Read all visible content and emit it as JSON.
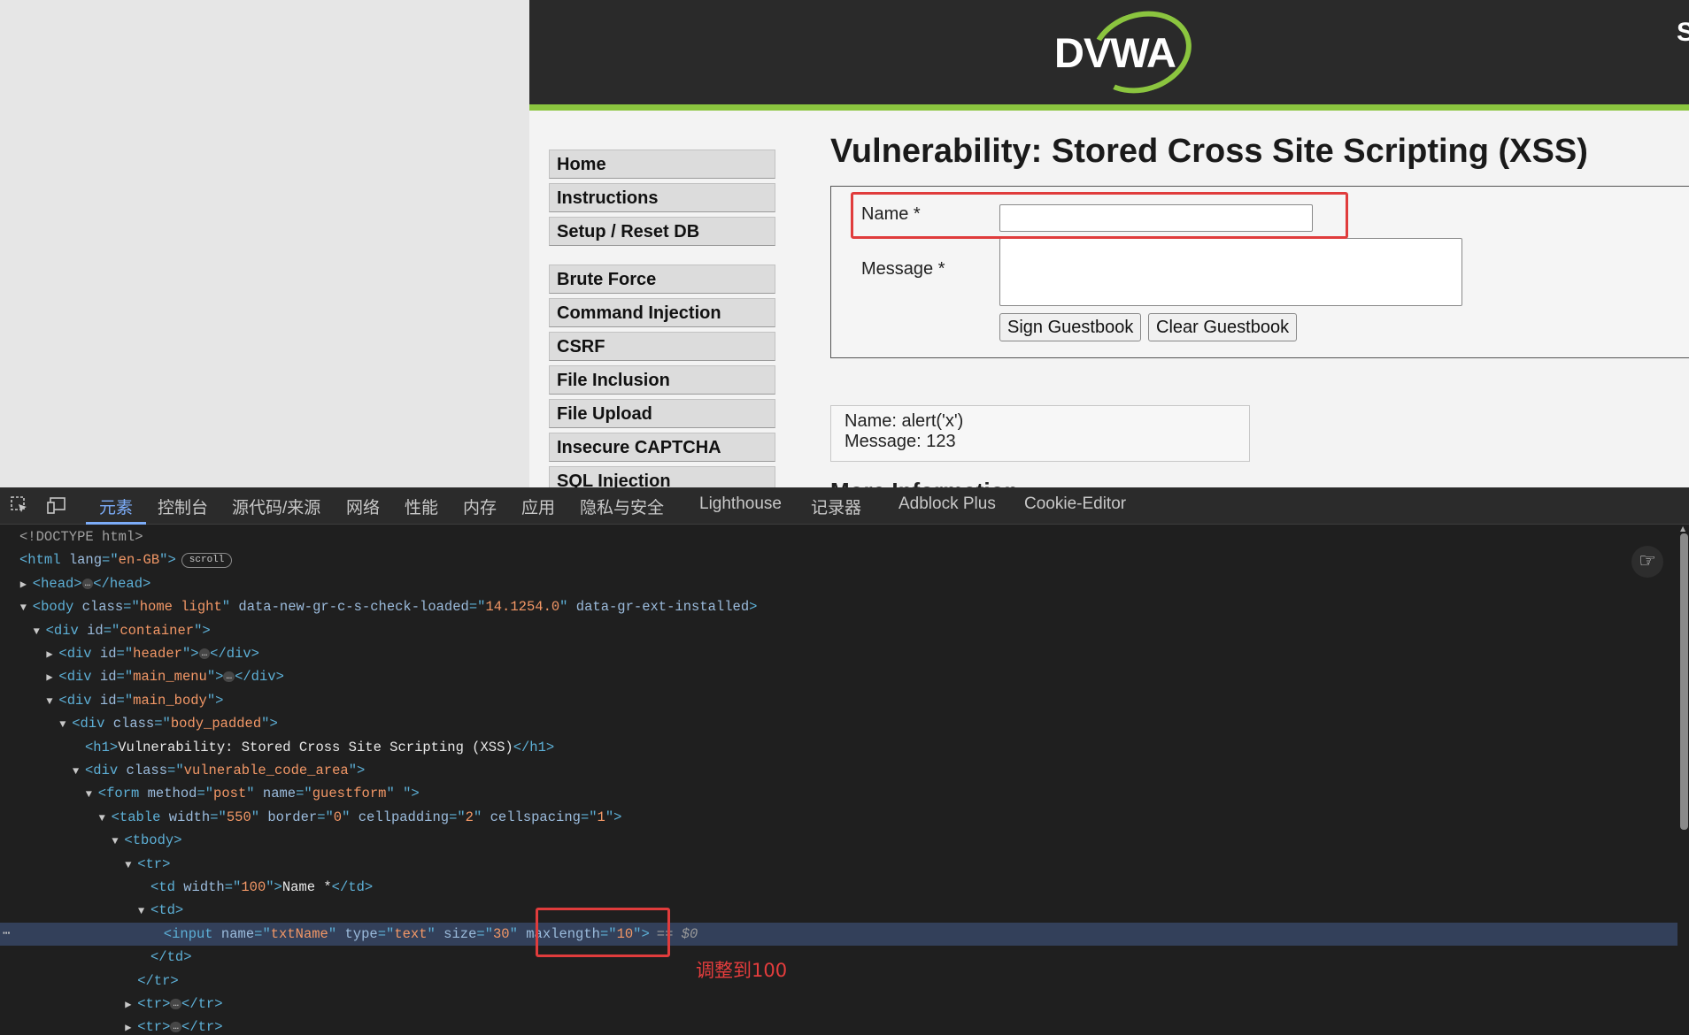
{
  "page": {
    "logo_text": "DVWA",
    "corner_glyph": "S",
    "menu": {
      "group1": [
        "Home",
        "Instructions",
        "Setup / Reset DB"
      ],
      "group2": [
        "Brute Force",
        "Command Injection",
        "CSRF",
        "File Inclusion",
        "File Upload",
        "Insecure CAPTCHA",
        "SQL Injection"
      ]
    },
    "title": "Vulnerability: Stored Cross Site Scripting (XSS)",
    "form": {
      "name_label": "Name *",
      "message_label": "Message *",
      "name_value": "",
      "message_value": "",
      "sign_button": "Sign Guestbook",
      "clear_button": "Clear Guestbook"
    },
    "entry": {
      "name_line": "Name: alert('x')",
      "message_line": "Message: 123"
    },
    "clipped_heading": "More Information"
  },
  "devtools": {
    "tabs": [
      "元素",
      "控制台",
      "源代码/来源",
      "网络",
      "性能",
      "内存",
      "应用",
      "隐私与安全",
      "Lighthouse",
      "记录器",
      "Adblock Plus",
      "Cookie-Editor"
    ],
    "icons": [
      "inspect-icon",
      "device-toolbar-icon"
    ],
    "scroll_badge": "scroll",
    "ellipsis": "…",
    "selected_suffix": "== $0",
    "row_menu": "⋯",
    "annotation": "调整到100",
    "accent_color": "#7cacf8",
    "highlight_color": "#e03c3c",
    "dom_lines": [
      {
        "indent": 0,
        "arrow": "",
        "segs": [
          {
            "c": "dt",
            "t": "<!DOCTYPE html>"
          }
        ]
      },
      {
        "indent": 0,
        "arrow": "",
        "segs": [
          {
            "c": "tag",
            "t": "<html"
          },
          {
            "c": "tx",
            "t": " "
          },
          {
            "c": "an",
            "t": "lang"
          },
          {
            "c": "tag",
            "t": "=\""
          },
          {
            "c": "av",
            "t": "en-GB"
          },
          {
            "c": "tag",
            "t": "\">"
          }
        ],
        "badge": true
      },
      {
        "indent": 1,
        "arrow": "▶",
        "segs": [
          {
            "c": "tag",
            "t": "<head>"
          }
        ],
        "dots": true,
        "close": "</head>"
      },
      {
        "indent": 1,
        "arrow": "▼",
        "segs": [
          {
            "c": "tag",
            "t": "<body"
          },
          {
            "c": "tx",
            "t": " "
          },
          {
            "c": "an",
            "t": "class"
          },
          {
            "c": "tag",
            "t": "=\""
          },
          {
            "c": "av",
            "t": "home light"
          },
          {
            "c": "tag",
            "t": "\""
          },
          {
            "c": "tx",
            "t": " "
          },
          {
            "c": "an",
            "t": "data-new-gr-c-s-check-loaded"
          },
          {
            "c": "tag",
            "t": "=\""
          },
          {
            "c": "av",
            "t": "14.1254.0"
          },
          {
            "c": "tag",
            "t": "\""
          },
          {
            "c": "tx",
            "t": " "
          },
          {
            "c": "an",
            "t": "data-gr-ext-installed"
          },
          {
            "c": "tag",
            "t": ">"
          }
        ]
      },
      {
        "indent": 2,
        "arrow": "▼",
        "segs": [
          {
            "c": "tag",
            "t": "<div"
          },
          {
            "c": "tx",
            "t": " "
          },
          {
            "c": "an",
            "t": "id"
          },
          {
            "c": "tag",
            "t": "=\""
          },
          {
            "c": "av",
            "t": "container"
          },
          {
            "c": "tag",
            "t": "\">"
          }
        ]
      },
      {
        "indent": 3,
        "arrow": "▶",
        "segs": [
          {
            "c": "tag",
            "t": "<div"
          },
          {
            "c": "tx",
            "t": " "
          },
          {
            "c": "an",
            "t": "id"
          },
          {
            "c": "tag",
            "t": "=\""
          },
          {
            "c": "av",
            "t": "header"
          },
          {
            "c": "tag",
            "t": "\">"
          }
        ],
        "dots": true,
        "close": "</div>"
      },
      {
        "indent": 3,
        "arrow": "▶",
        "segs": [
          {
            "c": "tag",
            "t": "<div"
          },
          {
            "c": "tx",
            "t": " "
          },
          {
            "c": "an",
            "t": "id"
          },
          {
            "c": "tag",
            "t": "=\""
          },
          {
            "c": "av",
            "t": "main_menu"
          },
          {
            "c": "tag",
            "t": "\">"
          }
        ],
        "dots": true,
        "close": "</div>"
      },
      {
        "indent": 3,
        "arrow": "▼",
        "segs": [
          {
            "c": "tag",
            "t": "<div"
          },
          {
            "c": "tx",
            "t": " "
          },
          {
            "c": "an",
            "t": "id"
          },
          {
            "c": "tag",
            "t": "=\""
          },
          {
            "c": "av",
            "t": "main_body"
          },
          {
            "c": "tag",
            "t": "\">"
          }
        ]
      },
      {
        "indent": 4,
        "arrow": "▼",
        "segs": [
          {
            "c": "tag",
            "t": "<div"
          },
          {
            "c": "tx",
            "t": " "
          },
          {
            "c": "an",
            "t": "class"
          },
          {
            "c": "tag",
            "t": "=\""
          },
          {
            "c": "av",
            "t": "body_padded"
          },
          {
            "c": "tag",
            "t": "\">"
          }
        ]
      },
      {
        "indent": 5,
        "arrow": "",
        "segs": [
          {
            "c": "tag",
            "t": "<h1>"
          },
          {
            "c": "tx",
            "t": "Vulnerability: Stored Cross Site Scripting (XSS)"
          },
          {
            "c": "tag",
            "t": "</h1>"
          }
        ]
      },
      {
        "indent": 5,
        "arrow": "▼",
        "segs": [
          {
            "c": "tag",
            "t": "<div"
          },
          {
            "c": "tx",
            "t": " "
          },
          {
            "c": "an",
            "t": "class"
          },
          {
            "c": "tag",
            "t": "=\""
          },
          {
            "c": "av",
            "t": "vulnerable_code_area"
          },
          {
            "c": "tag",
            "t": "\">"
          }
        ]
      },
      {
        "indent": 6,
        "arrow": "▼",
        "segs": [
          {
            "c": "tag",
            "t": "<form"
          },
          {
            "c": "tx",
            "t": " "
          },
          {
            "c": "an",
            "t": "method"
          },
          {
            "c": "tag",
            "t": "=\""
          },
          {
            "c": "av",
            "t": "post"
          },
          {
            "c": "tag",
            "t": "\""
          },
          {
            "c": "tx",
            "t": " "
          },
          {
            "c": "an",
            "t": "name"
          },
          {
            "c": "tag",
            "t": "=\""
          },
          {
            "c": "av",
            "t": "guestform"
          },
          {
            "c": "tag",
            "t": "\""
          },
          {
            "c": "tx",
            "t": " "
          },
          {
            "c": "tag",
            "t": "\">"
          }
        ]
      },
      {
        "indent": 7,
        "arrow": "▼",
        "segs": [
          {
            "c": "tag",
            "t": "<table"
          },
          {
            "c": "tx",
            "t": " "
          },
          {
            "c": "an",
            "t": "width"
          },
          {
            "c": "tag",
            "t": "=\""
          },
          {
            "c": "av",
            "t": "550"
          },
          {
            "c": "tag",
            "t": "\""
          },
          {
            "c": "tx",
            "t": " "
          },
          {
            "c": "an",
            "t": "border"
          },
          {
            "c": "tag",
            "t": "=\""
          },
          {
            "c": "av",
            "t": "0"
          },
          {
            "c": "tag",
            "t": "\""
          },
          {
            "c": "tx",
            "t": " "
          },
          {
            "c": "an",
            "t": "cellpadding"
          },
          {
            "c": "tag",
            "t": "=\""
          },
          {
            "c": "av",
            "t": "2"
          },
          {
            "c": "tag",
            "t": "\""
          },
          {
            "c": "tx",
            "t": " "
          },
          {
            "c": "an",
            "t": "cellspacing"
          },
          {
            "c": "tag",
            "t": "=\""
          },
          {
            "c": "av",
            "t": "1"
          },
          {
            "c": "tag",
            "t": "\">"
          }
        ]
      },
      {
        "indent": 8,
        "arrow": "▼",
        "segs": [
          {
            "c": "tag",
            "t": "<tbody>"
          }
        ]
      },
      {
        "indent": 9,
        "arrow": "▼",
        "segs": [
          {
            "c": "tag",
            "t": "<tr>"
          }
        ]
      },
      {
        "indent": 10,
        "arrow": "",
        "segs": [
          {
            "c": "tag",
            "t": "<td"
          },
          {
            "c": "tx",
            "t": " "
          },
          {
            "c": "an",
            "t": "width"
          },
          {
            "c": "tag",
            "t": "=\""
          },
          {
            "c": "av",
            "t": "100"
          },
          {
            "c": "tag",
            "t": "\">"
          },
          {
            "c": "tx",
            "t": "Name *"
          },
          {
            "c": "tag",
            "t": "</td>"
          }
        ]
      },
      {
        "indent": 10,
        "arrow": "▼",
        "segs": [
          {
            "c": "tag",
            "t": "<td>"
          }
        ]
      },
      {
        "indent": 11,
        "arrow": "",
        "selected": true,
        "segs": [
          {
            "c": "tag",
            "t": "<input"
          },
          {
            "c": "tx",
            "t": " "
          },
          {
            "c": "an",
            "t": "name"
          },
          {
            "c": "tag",
            "t": "=\""
          },
          {
            "c": "av",
            "t": "txtName"
          },
          {
            "c": "tag",
            "t": "\""
          },
          {
            "c": "tx",
            "t": " "
          },
          {
            "c": "an",
            "t": "type"
          },
          {
            "c": "tag",
            "t": "=\""
          },
          {
            "c": "av",
            "t": "text"
          },
          {
            "c": "tag",
            "t": "\""
          },
          {
            "c": "tx",
            "t": " "
          },
          {
            "c": "an",
            "t": "size"
          },
          {
            "c": "tag",
            "t": "=\""
          },
          {
            "c": "av",
            "t": "30"
          },
          {
            "c": "tag",
            "t": "\""
          },
          {
            "c": "tx",
            "t": " "
          },
          {
            "c": "an",
            "t": "maxlength"
          },
          {
            "c": "tag",
            "t": "=\""
          },
          {
            "c": "av",
            "t": "10"
          },
          {
            "c": "tag",
            "t": "\">"
          }
        ]
      },
      {
        "indent": 10,
        "arrow": "",
        "segs": [
          {
            "c": "tag",
            "t": "</td>"
          }
        ]
      },
      {
        "indent": 9,
        "arrow": "",
        "segs": [
          {
            "c": "tag",
            "t": "</tr>"
          }
        ]
      },
      {
        "indent": 9,
        "arrow": "▶",
        "segs": [
          {
            "c": "tag",
            "t": "<tr>"
          }
        ],
        "dots": true,
        "close": "</tr>"
      },
      {
        "indent": 9,
        "arrow": "▶",
        "segs": [
          {
            "c": "tag",
            "t": "<tr>"
          }
        ],
        "dots": true,
        "close": "</tr>"
      }
    ]
  }
}
